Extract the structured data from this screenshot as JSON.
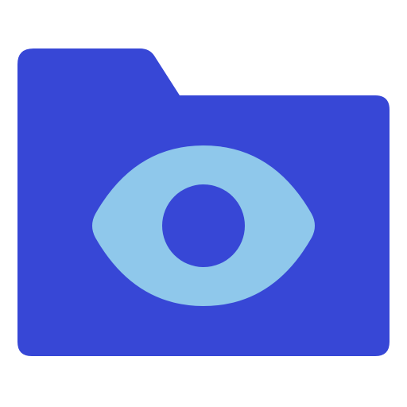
{
  "icon": {
    "name": "folder-eye-icon",
    "parts": [
      "folder-icon",
      "eye-icon"
    ],
    "colors": {
      "folder": "#3747d6",
      "eye": "#8fc8eb",
      "pupil": "#3747d6",
      "background": "#ffffff"
    }
  }
}
